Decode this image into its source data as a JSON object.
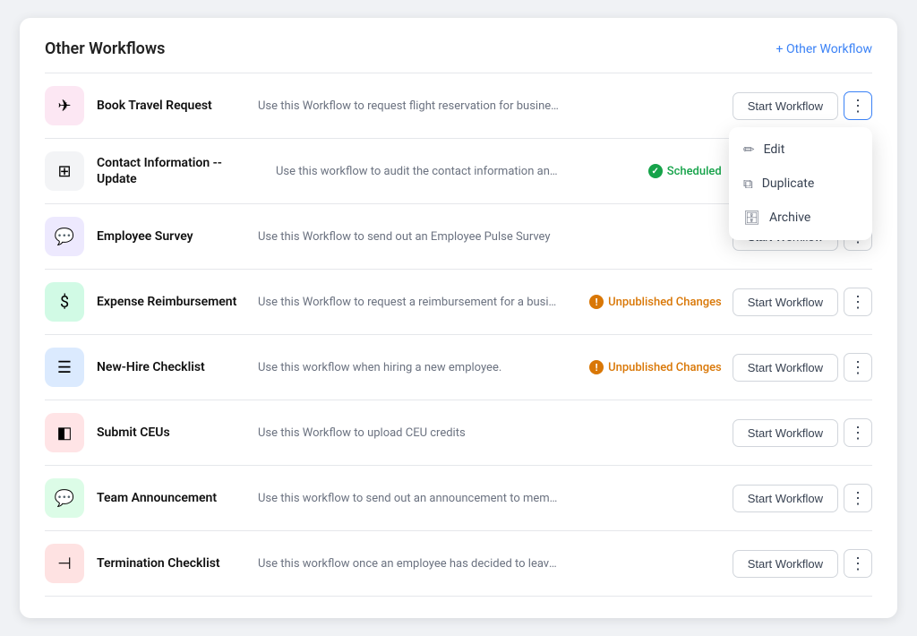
{
  "header": {
    "title": "Other Workflows",
    "add_link": "+ Other Workflow"
  },
  "workflows": [
    {
      "id": "book-travel",
      "name": "Book Travel Request",
      "description": "Use this Workflow to request flight reservation for business travel.",
      "icon": "✈",
      "iconBg": "icon-pink",
      "status": null,
      "showDropdown": true
    },
    {
      "id": "contact-info",
      "name": "Contact Information -- Update",
      "description": "Use this workflow to audit the contact information and make updates a...",
      "icon": "🏢",
      "iconBg": "icon-gray",
      "status": "scheduled",
      "statusLabel": "Scheduled",
      "showDropdown": false
    },
    {
      "id": "employee-survey",
      "name": "Employee Survey",
      "description": "Use this Workflow to send out an Employee Pulse Survey",
      "icon": "💬",
      "iconBg": "icon-purple",
      "status": null,
      "showDropdown": false
    },
    {
      "id": "expense-reimb",
      "name": "Expense Reimbursement",
      "description": "Use this Workflow to request a reimbursement for a business expense....",
      "icon": "$",
      "iconBg": "icon-green",
      "status": "unpublished",
      "statusLabel": "Unpublished Changes",
      "showDropdown": false
    },
    {
      "id": "new-hire",
      "name": "New-Hire Checklist",
      "description": "Use this workflow when hiring a new employee.",
      "icon": "☰",
      "iconBg": "icon-blue",
      "status": "unpublished",
      "statusLabel": "Unpublished Changes",
      "showDropdown": false
    },
    {
      "id": "submit-ceus",
      "name": "Submit CEUs",
      "description": "Use this Workflow to upload CEU credits",
      "icon": "📋",
      "iconBg": "icon-rose",
      "status": null,
      "showDropdown": false
    },
    {
      "id": "team-announce",
      "name": "Team Announcement",
      "description": "Use this workflow to send out an announcement to members of your t...",
      "icon": "💬",
      "iconBg": "icon-green2",
      "status": null,
      "showDropdown": false
    },
    {
      "id": "termination",
      "name": "Termination Checklist",
      "description": "Use this workflow once an employee has decided to leave or has bee...",
      "icon": "🚪",
      "iconBg": "icon-red",
      "status": null,
      "showDropdown": false
    }
  ],
  "buttons": {
    "start_workflow": "Start Workflow",
    "edit": "Edit",
    "duplicate": "Duplicate",
    "archive": "Archive"
  }
}
